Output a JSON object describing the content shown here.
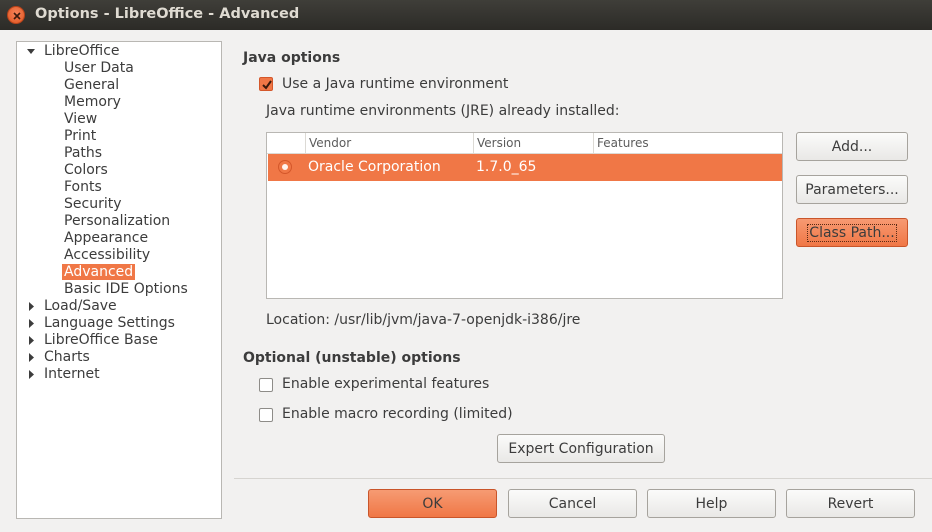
{
  "window": {
    "title": "Options - LibreOffice - Advanced"
  },
  "tree": {
    "items": [
      {
        "label": "LibreOffice",
        "level": 0,
        "expanded": true
      },
      {
        "label": "User Data",
        "level": 1
      },
      {
        "label": "General",
        "level": 1
      },
      {
        "label": "Memory",
        "level": 1
      },
      {
        "label": "View",
        "level": 1
      },
      {
        "label": "Print",
        "level": 1
      },
      {
        "label": "Paths",
        "level": 1
      },
      {
        "label": "Colors",
        "level": 1
      },
      {
        "label": "Fonts",
        "level": 1
      },
      {
        "label": "Security",
        "level": 1
      },
      {
        "label": "Personalization",
        "level": 1
      },
      {
        "label": "Appearance",
        "level": 1
      },
      {
        "label": "Accessibility",
        "level": 1
      },
      {
        "label": "Advanced",
        "level": 1,
        "selected": true
      },
      {
        "label": "Basic IDE Options",
        "level": 1
      },
      {
        "label": "Load/Save",
        "level": 0,
        "expanded": false
      },
      {
        "label": "Language Settings",
        "level": 0,
        "expanded": false
      },
      {
        "label": "LibreOffice Base",
        "level": 0,
        "expanded": false
      },
      {
        "label": "Charts",
        "level": 0,
        "expanded": false
      },
      {
        "label": "Internet",
        "level": 0,
        "expanded": false
      }
    ]
  },
  "java": {
    "section_title": "Java options",
    "use_java_label": "Use a Java runtime environment",
    "use_java_checked": true,
    "installed_label": "Java runtime environments (JRE) already installed:",
    "columns": [
      "Vendor",
      "Version",
      "Features"
    ],
    "rows": [
      {
        "vendor": "Oracle Corporation",
        "version": "1.7.0_65",
        "features": "",
        "selected": true
      }
    ],
    "location": "Location: /usr/lib/jvm/java-7-openjdk-i386/jre",
    "add_button": "Add...",
    "parameters_button": "Parameters...",
    "classpath_button": "Class Path..."
  },
  "optional": {
    "section_title": "Optional (unstable) options",
    "experimental_label": "Enable experimental features",
    "experimental_checked": false,
    "macro_label": "Enable macro recording (limited)",
    "macro_checked": false,
    "expert_button": "Expert Configuration"
  },
  "footer": {
    "ok": "OK",
    "cancel": "Cancel",
    "help": "Help",
    "revert": "Revert"
  },
  "colors": {
    "accent": "#f07746",
    "titlebar": "#3c3b37",
    "background": "#f2f1f0"
  }
}
